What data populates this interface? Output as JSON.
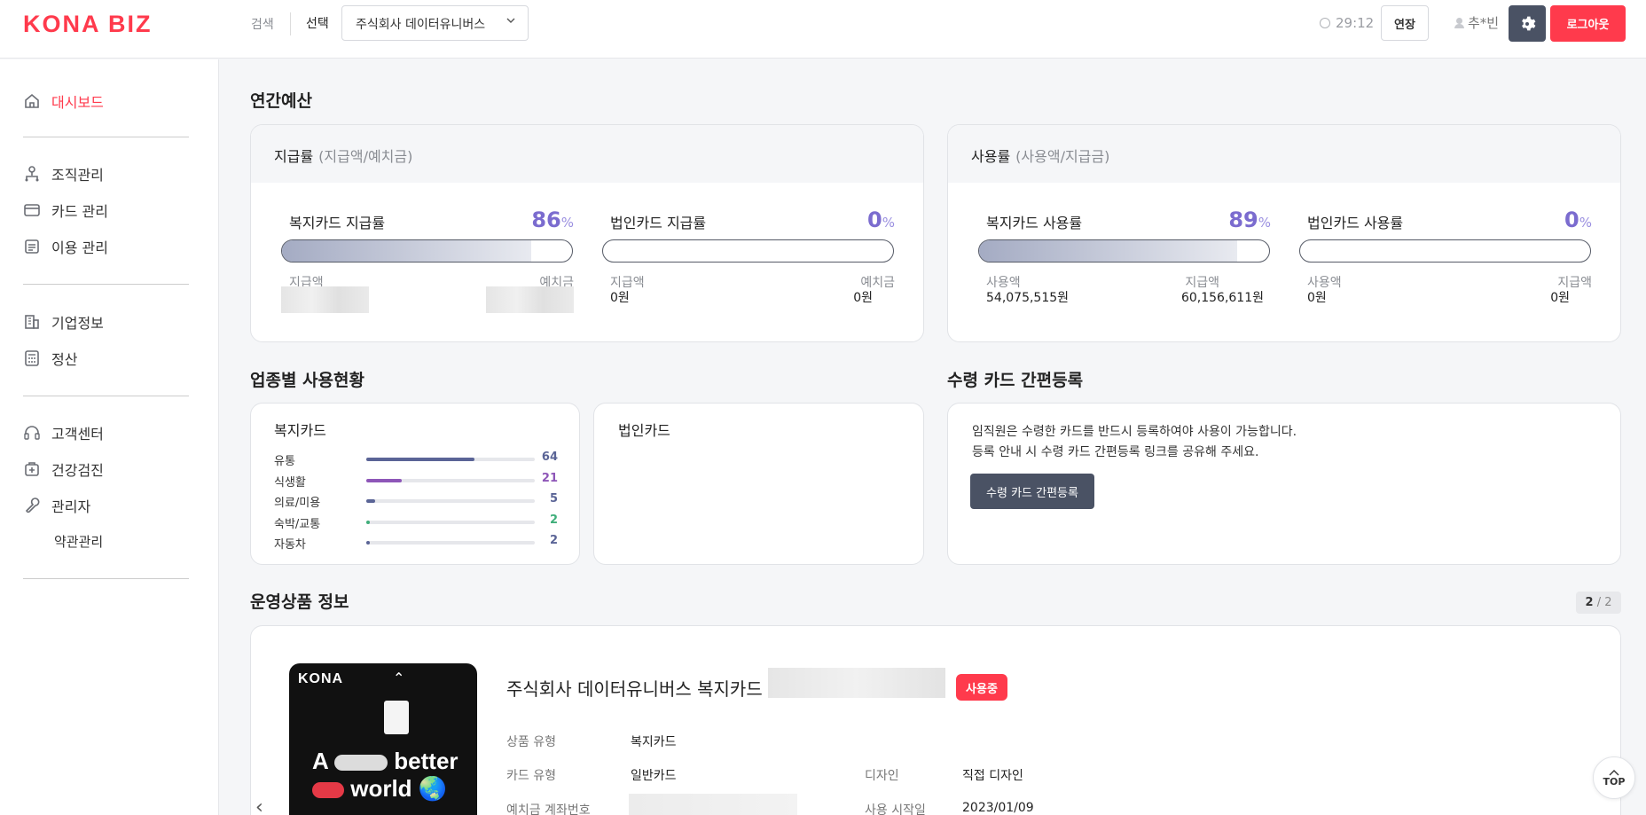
{
  "header": {
    "logo": "KONA BIZ",
    "search_label": "검색",
    "select_label": "선택",
    "company_select": "주식회사 데이터유니버스",
    "timer": "29:12",
    "extend_label": "연장",
    "user_name": "추*빈",
    "logout_label": "로그아웃"
  },
  "sidebar": {
    "items": [
      {
        "label": "대시보드",
        "icon": "home-icon"
      },
      {
        "label": "조직관리",
        "icon": "org-icon"
      },
      {
        "label": "카드 관리",
        "icon": "card-icon"
      },
      {
        "label": "이용 관리",
        "icon": "usage-icon"
      },
      {
        "label": "기업정보",
        "icon": "building-icon"
      },
      {
        "label": "정산",
        "icon": "calculator-icon"
      },
      {
        "label": "고객센터",
        "icon": "headset-icon"
      },
      {
        "label": "건강검진",
        "icon": "medical-icon"
      },
      {
        "label": "관리자",
        "icon": "wrench-icon"
      },
      {
        "label": "약관관리",
        "icon": ""
      }
    ]
  },
  "annual_budget": {
    "title": "연간예산",
    "payout": {
      "head": "지급률",
      "head_sub": "(지급액/예치금)",
      "welfare": {
        "label": "복지카드 지급률",
        "value": "86",
        "unit": "%",
        "fraction": 0.86,
        "left_label": "지급액",
        "right_label": "예치금"
      },
      "corporate": {
        "label": "법인카드 지급률",
        "value": "0",
        "unit": "%",
        "fraction": 0,
        "left_label": "지급액",
        "left_amount": "0원",
        "right_label": "예치금",
        "right_amount": "0원"
      }
    },
    "usage": {
      "head": "사용률",
      "head_sub": "(사용액/지급금)",
      "welfare": {
        "label": "복지카드 사용률",
        "value": "89",
        "unit": "%",
        "fraction": 0.89,
        "left_label": "사용액",
        "left_amount": "54,075,515원",
        "right_label": "지급액",
        "right_amount": "60,156,611원"
      },
      "corporate": {
        "label": "법인카드 사용률",
        "value": "0",
        "unit": "%",
        "fraction": 0,
        "left_label": "사용액",
        "left_amount": "0원",
        "right_label": "지급액",
        "right_amount": "0원"
      }
    }
  },
  "category_usage": {
    "title": "업종별 사용현황",
    "welfare_title": "복지카드",
    "corporate_title": "법인카드",
    "rows": [
      {
        "name": "유통",
        "value": "64",
        "fraction": 0.64,
        "color": "#5a6496"
      },
      {
        "name": "식생활",
        "value": "21",
        "fraction": 0.21,
        "color": "#8e56b8"
      },
      {
        "name": "의료/미용",
        "value": "5",
        "fraction": 0.05,
        "color": "#5a6496"
      },
      {
        "name": "숙박/교통",
        "value": "2",
        "fraction": 0.02,
        "color": "#3fae7a"
      },
      {
        "name": "자동차",
        "value": "2",
        "fraction": 0.02,
        "color": "#5a6496"
      }
    ]
  },
  "quick_register": {
    "title": "수령 카드 간편등록",
    "line1": "임직원은 수령한 카드를 반드시 등록하여야 사용이 가능합니다.",
    "line2": "등록 안내 시 수령 카드 간편등록 링크를 공유해 주세요.",
    "button": "수령 카드 간편등록"
  },
  "products": {
    "title": "운영상품 정보",
    "page_current": "2",
    "page_total": "/ 2",
    "card_logo": "KONA",
    "card_slogan_1": "A",
    "card_slogan_1b": "better",
    "card_slogan_2": "world",
    "name": "주식회사 데이터유니버스 복지카드",
    "status": "사용중",
    "fields": [
      {
        "key": "상품 유형",
        "value": "복지카드"
      },
      {
        "key": "카드 유형",
        "value": "일반카드"
      },
      {
        "key": "디자인",
        "value": "직접 디자인"
      },
      {
        "key": "예치금 계좌번호",
        "value": ""
      },
      {
        "key": "사용 시작일",
        "value": "2023/01/09"
      }
    ]
  },
  "top_button": "TOP",
  "colors": {
    "brand": "#ff3a4c",
    "accent": "#7b6ccf",
    "dark_button": "#4a5264"
  }
}
